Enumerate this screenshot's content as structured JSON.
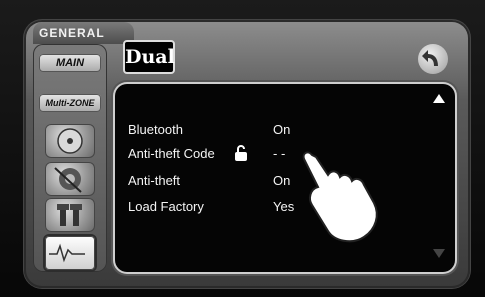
{
  "header": {
    "section": "GENERAL",
    "brand": "Dual"
  },
  "sidebar": {
    "main_label": "MAIN",
    "multizone_label": "Multi-ZONE"
  },
  "settings": [
    {
      "label": "Bluetooth",
      "value": "On"
    },
    {
      "label": "Anti-theft  Code",
      "value": "- -"
    },
    {
      "label": "Anti-theft",
      "value": "On"
    },
    {
      "label": "Load Factory",
      "value": "Yes"
    }
  ],
  "icons": {
    "disc": "disc-icon",
    "speaker": "speaker-icon",
    "tools": "tools-icon",
    "eq": "equalizer-icon",
    "lock": "lock-icon",
    "back": "back-icon",
    "hand": "pointing-hand-icon"
  }
}
